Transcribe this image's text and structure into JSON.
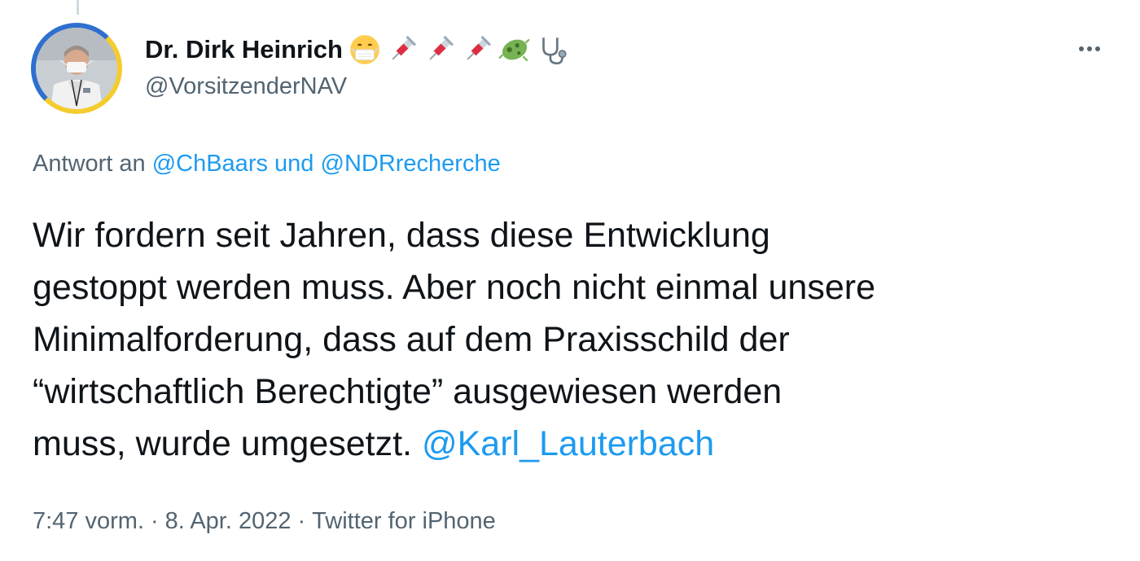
{
  "author": {
    "display_name": "Dr. Dirk Heinrich",
    "handle": "@VorsitzenderNAV",
    "name_emojis": [
      "face-with-medical-mask-icon",
      "syringe-icon",
      "syringe-icon",
      "syringe-icon",
      "microbe-icon",
      "stethoscope-icon"
    ]
  },
  "more_menu": {
    "icon": "more-horizontal-icon"
  },
  "reply": {
    "prefix": "Antwort an",
    "mention_1": "@ChBaars",
    "conjunction": "und",
    "mention_2": "@NDRrecherche"
  },
  "tweet": {
    "lines": [
      "Wir fordern seit Jahren, dass diese Entwicklung",
      "gestoppt werden muss. Aber noch nicht einmal unsere",
      "Minimalforderung, dass auf dem Praxisschild der",
      "“wirtschaftlich Berechtigte” ausgewiesen werden"
    ],
    "last_line_text": "muss, wurde umgesetzt.",
    "last_line_mention": "@Karl_Lauterbach"
  },
  "meta": {
    "time": "7:47 vorm.",
    "separator": "·",
    "date": "8. Apr. 2022",
    "source": "Twitter for iPhone"
  },
  "colors": {
    "text": "#0f1419",
    "secondary": "#536471",
    "link": "#1d9bf0",
    "avatar_ring_blue": "#2f6fcf",
    "avatar_ring_yellow": "#f4cc2e"
  }
}
